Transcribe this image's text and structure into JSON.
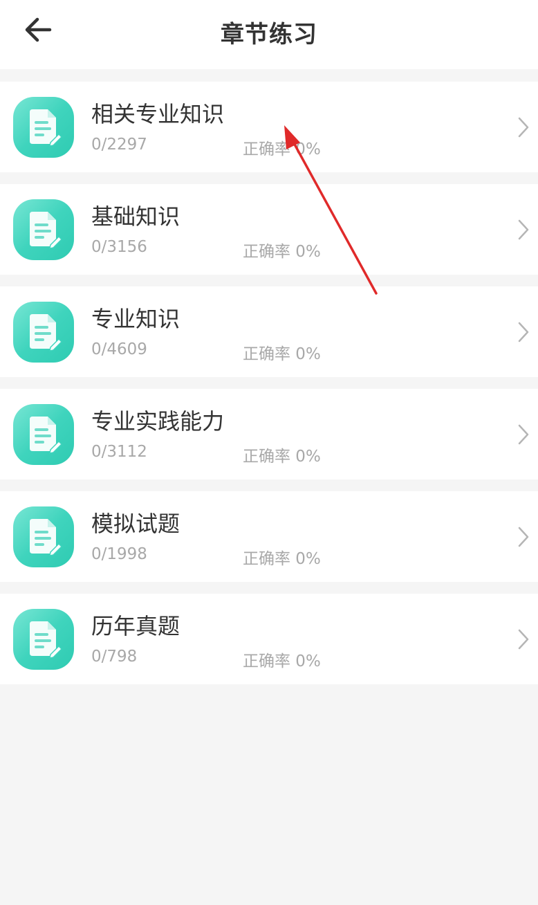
{
  "header": {
    "title": "章节练习",
    "back_icon": "arrow-left-icon"
  },
  "items": [
    {
      "title": "相关专业知识",
      "progress": "0/2297",
      "accuracy": "正确率 0%",
      "icon": "document-edit-icon"
    },
    {
      "title": "基础知识",
      "progress": "0/3156",
      "accuracy": "正确率 0%",
      "icon": "document-edit-icon"
    },
    {
      "title": "专业知识",
      "progress": "0/4609",
      "accuracy": "正确率 0%",
      "icon": "document-edit-icon"
    },
    {
      "title": "专业实践能力",
      "progress": "0/3112",
      "accuracy": "正确率 0%",
      "icon": "document-edit-icon"
    },
    {
      "title": "模拟试题",
      "progress": "0/1998",
      "accuracy": "正确率 0%",
      "icon": "document-edit-icon"
    },
    {
      "title": "历年真题",
      "progress": "0/798",
      "accuracy": "正确率 0%",
      "icon": "document-edit-icon"
    }
  ],
  "colors": {
    "icon_gradient_start": "#78e6d4",
    "icon_gradient_end": "#2fcbb2",
    "annotation_arrow": "#e02a2a",
    "background": "#f5f5f5"
  },
  "annotation": {
    "type": "arrow",
    "icon": "red-arrow-annotation"
  }
}
